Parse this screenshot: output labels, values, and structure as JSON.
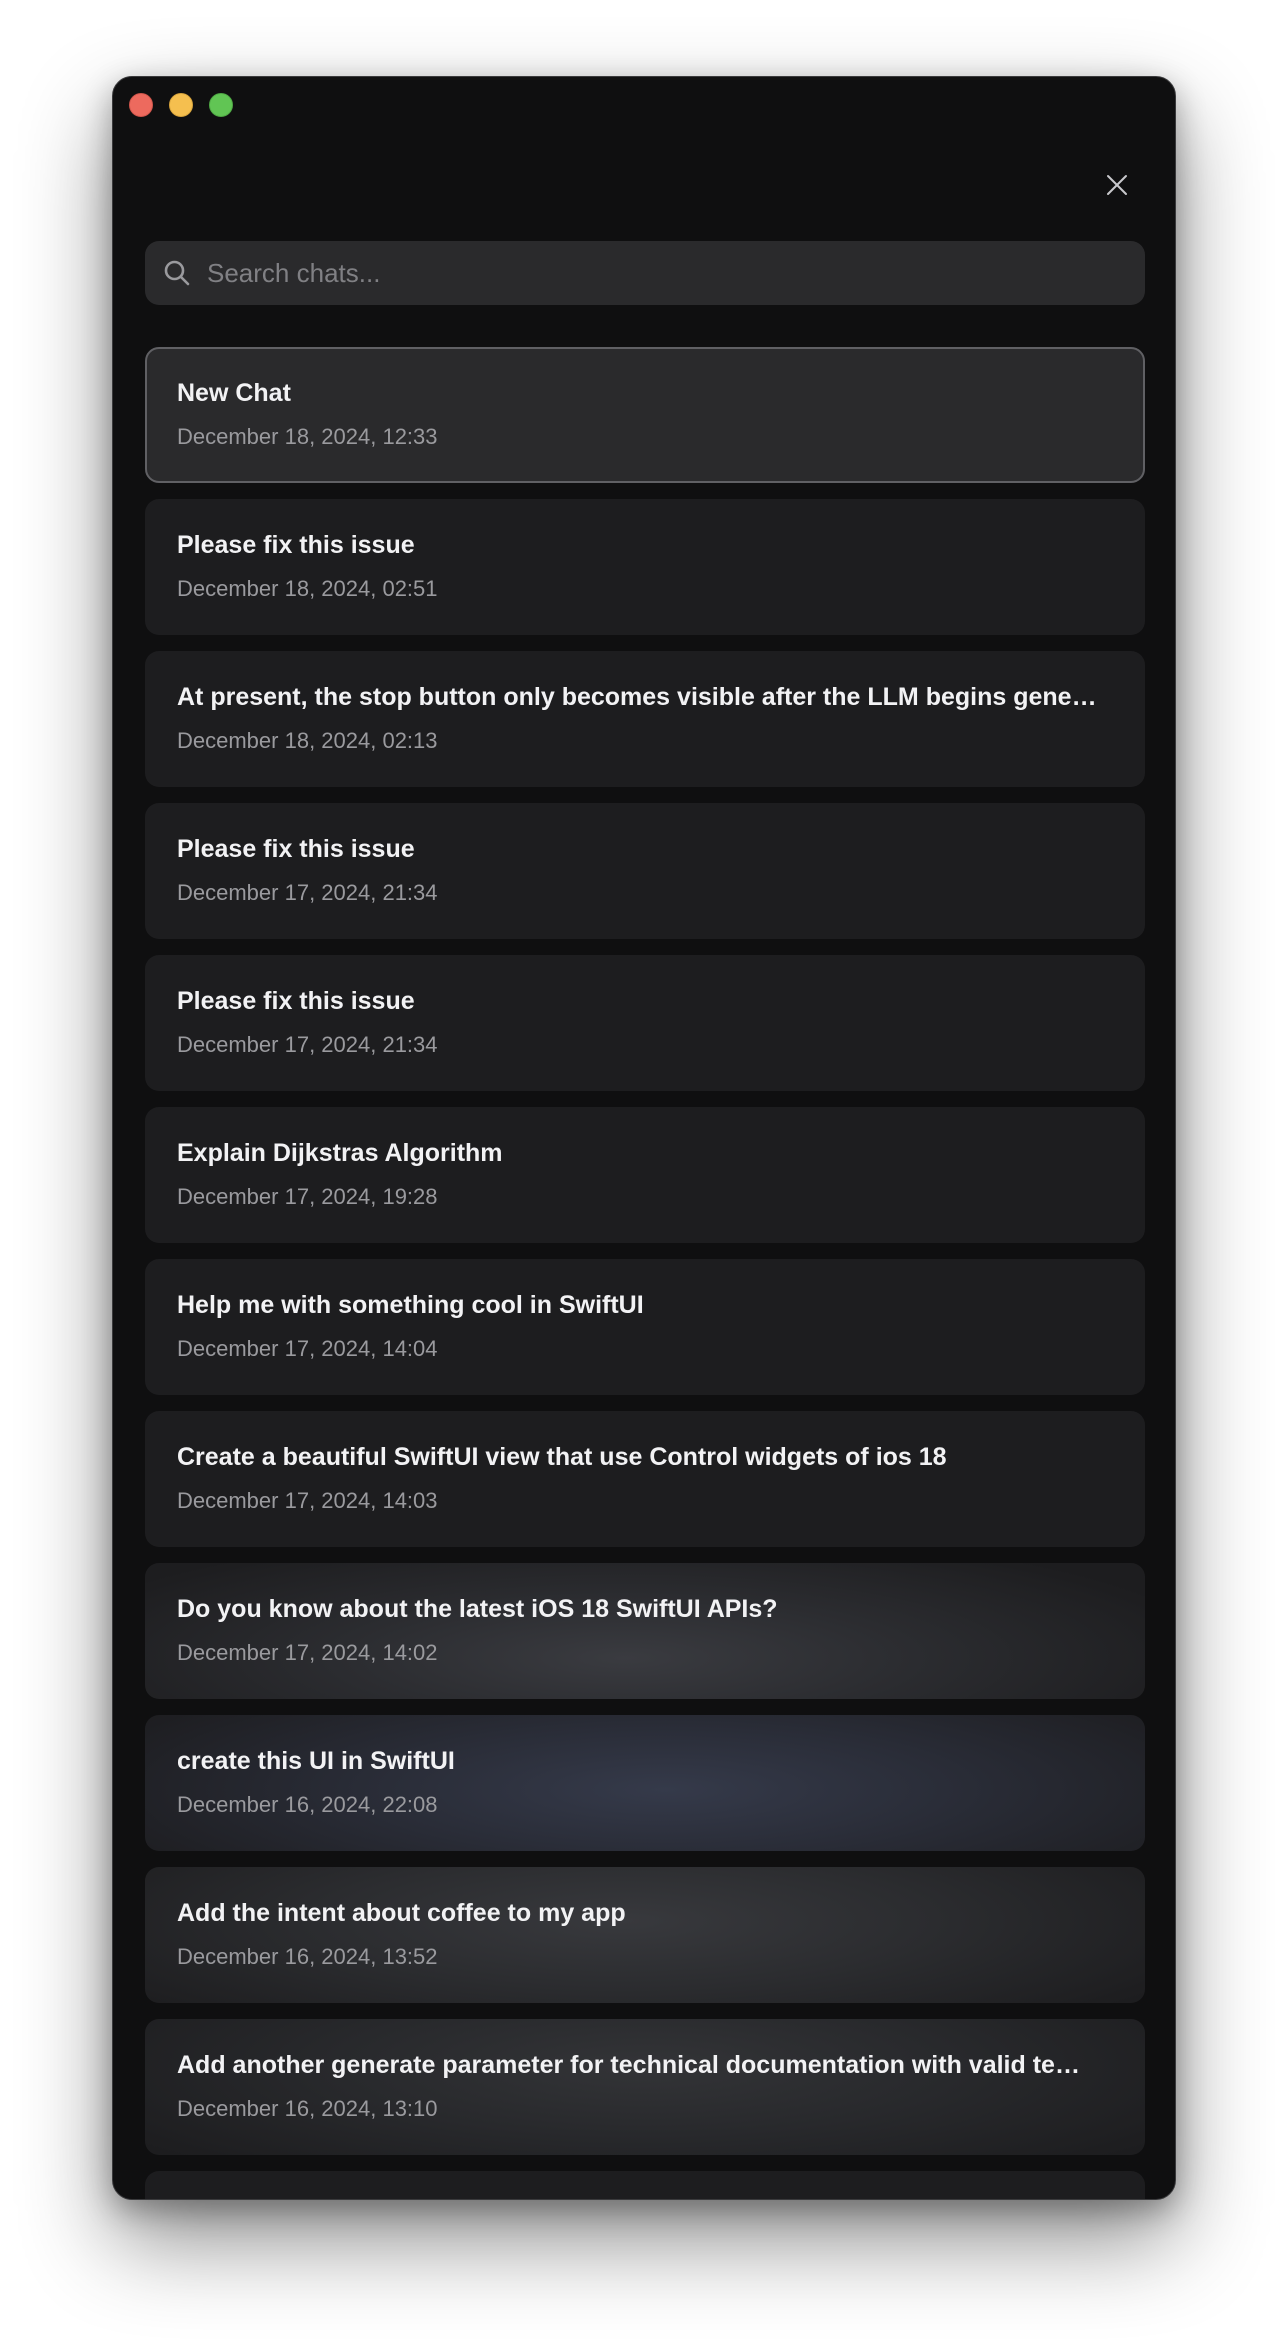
{
  "search": {
    "placeholder": "Search chats..."
  },
  "colors": {
    "window_background": "#0f0f10",
    "card_background": "#1d1d1f",
    "selected_card_background": "#2a2a2c",
    "selected_border": "#606064",
    "title_text": "#f2f2f4",
    "date_text": "#9a9a9e",
    "traffic_red": "#ed6a5e",
    "traffic_yellow": "#f5bf4f",
    "traffic_green": "#61c554"
  },
  "icons": {
    "close": "close-icon",
    "search": "search-icon"
  },
  "chats": [
    {
      "title": "New Chat",
      "date": "December 18, 2024, 12:33"
    },
    {
      "title": "Please fix this issue",
      "date": "December 18, 2024, 02:51"
    },
    {
      "title": "At present, the stop button only becomes visible after the LLM begins gener...",
      "date": "December 18, 2024, 02:13"
    },
    {
      "title": "Please fix this issue",
      "date": "December 17, 2024, 21:34"
    },
    {
      "title": "Please fix this issue",
      "date": "December 17, 2024, 21:34"
    },
    {
      "title": "Explain Dijkstras Algorithm",
      "date": "December 17, 2024, 19:28"
    },
    {
      "title": "Help me with something cool in SwiftUI",
      "date": "December 17, 2024, 14:04"
    },
    {
      "title": "Create a beautiful SwiftUI view that use Control widgets of ios 18",
      "date": "December 17, 2024, 14:03"
    },
    {
      "title": "Do you know about the latest iOS 18 SwiftUI APIs?",
      "date": "December 17, 2024, 14:02"
    },
    {
      "title": "create this UI in SwiftUI",
      "date": "December 16, 2024, 22:08"
    },
    {
      "title": "Add the intent about coffee to my app",
      "date": "December 16, 2024, 13:52"
    },
    {
      "title": "Add another generate parameter for technical documentation with valid tem...",
      "date": "December 16, 2024, 13:10"
    }
  ]
}
